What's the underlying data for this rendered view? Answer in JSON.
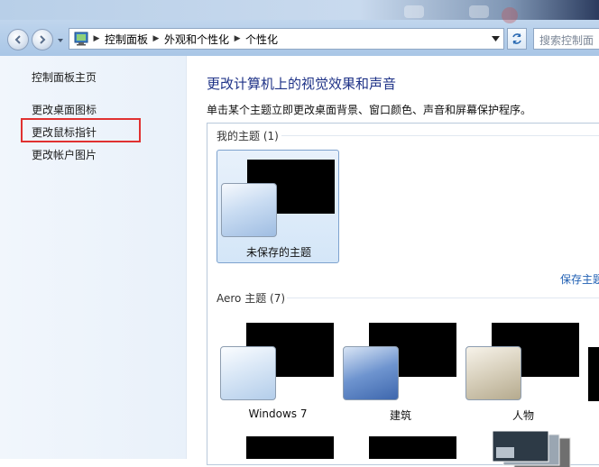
{
  "address_bar": {
    "crumbs": [
      "控制面板",
      "外观和个性化",
      "个性化"
    ]
  },
  "search": {
    "placeholder": "搜索控制面"
  },
  "left_pane": {
    "items": [
      {
        "label": "控制面板主页"
      },
      {
        "label": "更改桌面图标"
      },
      {
        "label": "更改鼠标指针"
      },
      {
        "label": "更改帐户图片"
      }
    ]
  },
  "main": {
    "title": "更改计算机上的视觉效果和声音",
    "subtitle": "单击某个主题立即更改桌面背景、窗口颜色、声音和屏幕保护程序。",
    "my_themes": {
      "label": "我的主题 (1)",
      "themes": [
        {
          "name": "未保存的主题",
          "selected": true
        }
      ],
      "save_link": "保存主题"
    },
    "aero_themes": {
      "label": "Aero 主题 (7)",
      "themes": [
        {
          "name": "Windows 7"
        },
        {
          "name": "建筑"
        },
        {
          "name": "人物"
        }
      ]
    }
  },
  "colors": {
    "highlight_box": "#e03131",
    "title_blue": "#1e3287",
    "link_blue": "#1f5fb3"
  }
}
